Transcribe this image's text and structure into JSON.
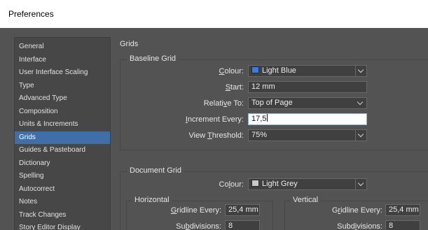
{
  "window": {
    "title": "Preferences"
  },
  "sidebar": {
    "items": [
      {
        "label": "General"
      },
      {
        "label": "Interface"
      },
      {
        "label": "User Interface Scaling"
      },
      {
        "label": "Type"
      },
      {
        "label": "Advanced Type"
      },
      {
        "label": "Composition"
      },
      {
        "label": "Units & Increments"
      },
      {
        "label": "Grids"
      },
      {
        "label": "Guides & Pasteboard"
      },
      {
        "label": "Dictionary"
      },
      {
        "label": "Spelling"
      },
      {
        "label": "Autocorrect"
      },
      {
        "label": "Notes"
      },
      {
        "label": "Track Changes"
      },
      {
        "label": "Story Editor Display"
      }
    ],
    "selected": "Grids"
  },
  "panel": {
    "title": "Grids"
  },
  "baseline_grid": {
    "group_label": "Baseline Grid",
    "colour": {
      "label_pre": "",
      "label_u": "C",
      "label_post": "olour:",
      "value": "Light Blue",
      "swatch_color": "#3d7be0"
    },
    "start": {
      "label_pre": "",
      "label_u": "S",
      "label_post": "tart:",
      "value": "12 mm"
    },
    "relative_to": {
      "label_pre": "Relati",
      "label_u": "v",
      "label_post": "e To:",
      "value": "Top of Page"
    },
    "increment_every": {
      "label_pre": "",
      "label_u": "I",
      "label_post": "ncrement Every:",
      "value": "17,5"
    },
    "view_threshold": {
      "label_pre": "View ",
      "label_u": "T",
      "label_post": "hreshold:",
      "value": "75%"
    }
  },
  "document_grid": {
    "group_label": "Document Grid",
    "colour": {
      "label_pre": "Co",
      "label_u": "l",
      "label_post": "our:",
      "value": "Light Grey",
      "swatch_color": "#c8c8c8"
    },
    "horizontal": {
      "label": "Horizontal",
      "gridline_every": {
        "label_pre": "",
        "label_u": "G",
        "label_post": "ridline Every:",
        "value": "25,4 mm"
      },
      "subdivisions": {
        "label_pre": "Su",
        "label_u": "b",
        "label_post": "divisions:",
        "value": "8"
      }
    },
    "vertical": {
      "label": "Vertical",
      "gridline_every": {
        "label_pre": "G",
        "label_u": "r",
        "label_post": "idline Every:",
        "value": "25,4 mm"
      },
      "subdivisions": {
        "label_pre": "Subd",
        "label_u": "i",
        "label_post": "visions:",
        "value": "8"
      }
    }
  },
  "colors": {
    "selection": "#3f6fa8",
    "background": "#535353"
  }
}
